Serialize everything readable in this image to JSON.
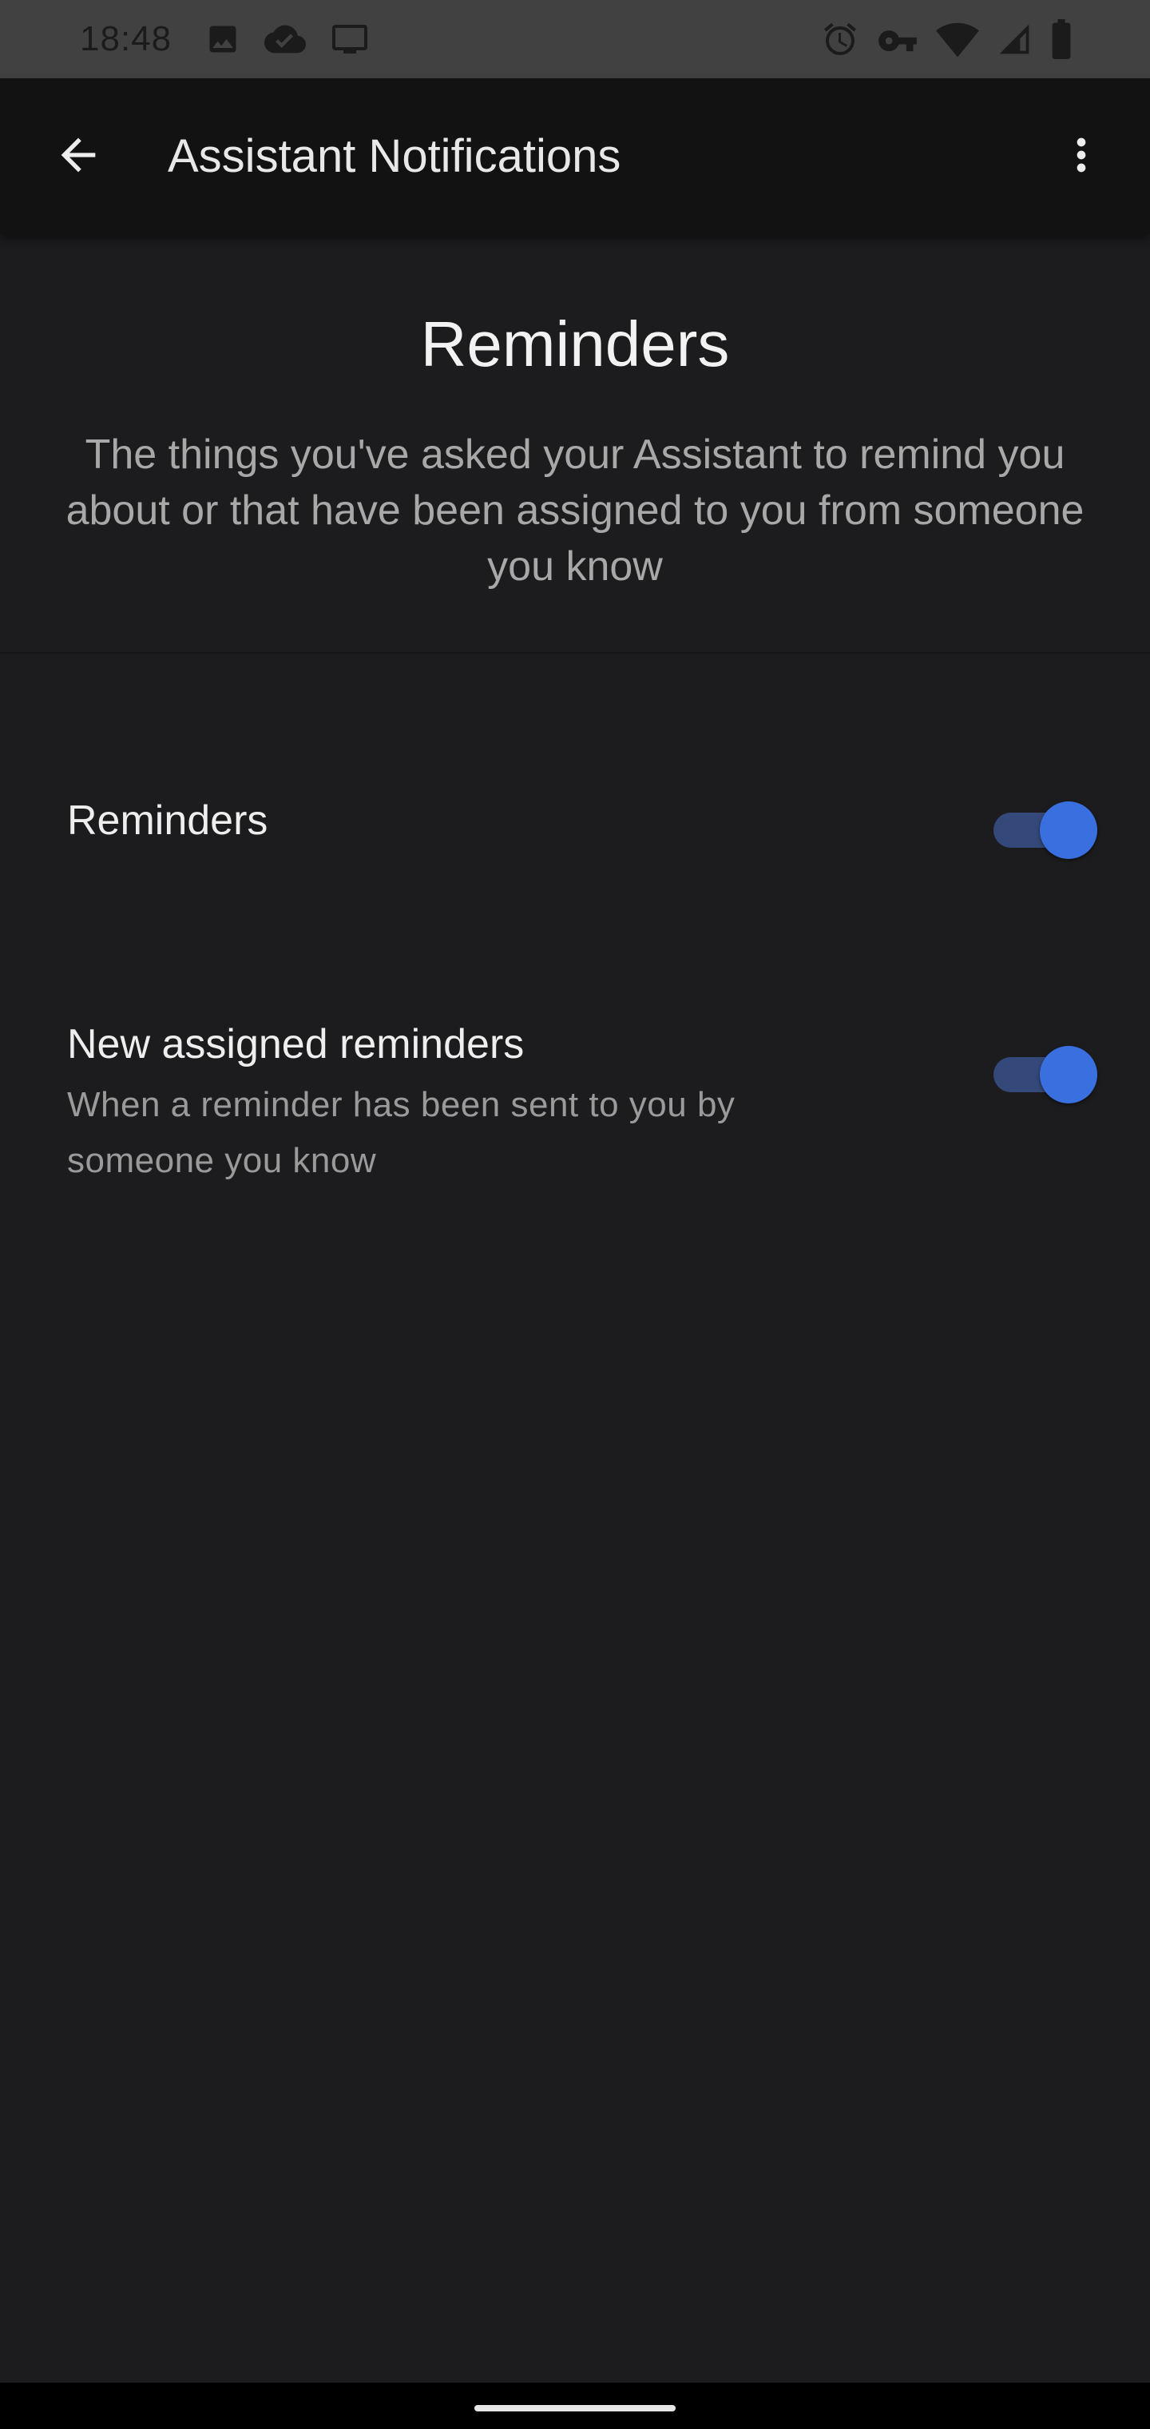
{
  "status_bar": {
    "time": "18:48",
    "left_icons": [
      "image-icon",
      "cloud-icon",
      "cast-icon"
    ],
    "right_icons": [
      "alarm-icon",
      "vpn-key-icon",
      "wifi-icon",
      "signal-icon",
      "battery-icon"
    ]
  },
  "app_bar": {
    "title": "Assistant Notifications",
    "back_icon": "arrow-back-icon",
    "menu_icon": "more-vert-icon"
  },
  "header": {
    "title": "Reminders",
    "description": "The things you've asked your Assistant to remind you about or that have been assigned to you from someone you know"
  },
  "settings": [
    {
      "label": "Reminders",
      "enabled": true
    },
    {
      "label": "New assigned reminders",
      "subtitle": "When a reminder has been sent to you by someone you know",
      "enabled": true
    }
  ],
  "colors": {
    "background": "#1c1c1e",
    "app_bar": "#121212",
    "status_bar": "#414141",
    "toggle_thumb": "#3a6fe0",
    "toggle_track": "#34497a"
  }
}
